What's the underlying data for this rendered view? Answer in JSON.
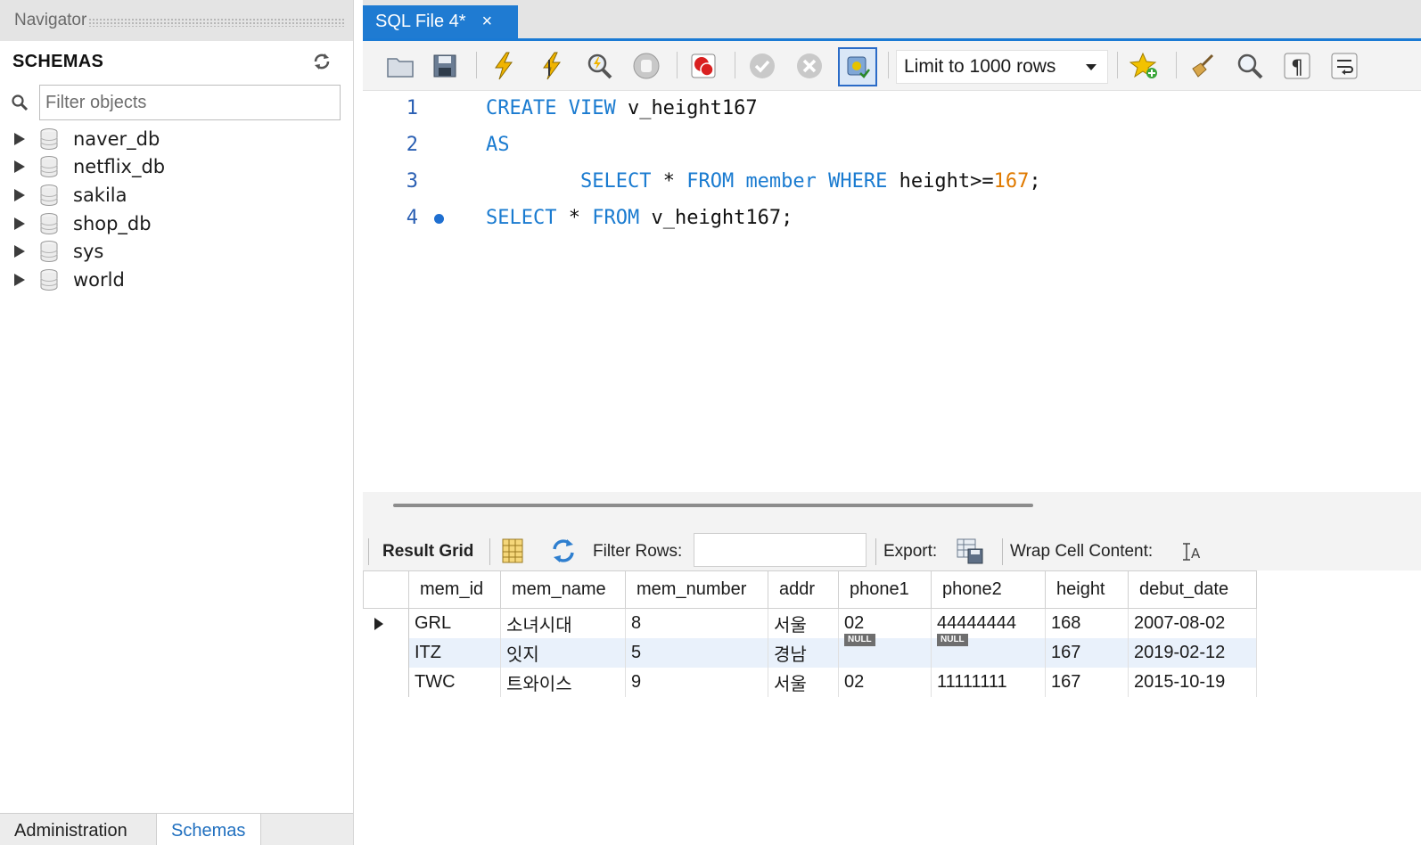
{
  "navigator": {
    "title": "Navigator",
    "schemas_header": "SCHEMAS",
    "filter_placeholder": "Filter objects",
    "schemas": [
      "naver_db",
      "netflix_db",
      "sakila",
      "shop_db",
      "sys",
      "world"
    ],
    "bottom_tabs": {
      "administration": "Administration",
      "schemas": "Schemas"
    },
    "active_bottom_tab": "Schemas"
  },
  "editor": {
    "tab_title": "SQL File 4*",
    "tab_close": "×",
    "limit_label": "Limit to 1000 rows",
    "lines": [
      {
        "number": "1",
        "tokens": [
          {
            "t": "CREATE VIEW",
            "k": "kw"
          },
          {
            "t": " v_height167",
            "k": ""
          }
        ]
      },
      {
        "number": "2",
        "tokens": [
          {
            "t": "AS",
            "k": "kw"
          }
        ]
      },
      {
        "number": "3",
        "tokens": [
          {
            "t": "        ",
            "k": ""
          },
          {
            "t": "SELECT",
            "k": "kw"
          },
          {
            "t": " * ",
            "k": ""
          },
          {
            "t": "FROM",
            "k": "kw"
          },
          {
            "t": " ",
            "k": ""
          },
          {
            "t": "member",
            "k": "kw"
          },
          {
            "t": " ",
            "k": ""
          },
          {
            "t": "WHERE",
            "k": "kw"
          },
          {
            "t": " height>=",
            "k": ""
          },
          {
            "t": "167",
            "k": "num"
          },
          {
            "t": ";",
            "k": ""
          }
        ]
      },
      {
        "number": "4",
        "marker": true,
        "tokens": [
          {
            "t": "SELECT",
            "k": "kw"
          },
          {
            "t": " * ",
            "k": ""
          },
          {
            "t": "FROM",
            "k": "kw"
          },
          {
            "t": " v_height167;",
            "k": ""
          }
        ]
      }
    ]
  },
  "results": {
    "toolbar": {
      "result_grid_label": "Result Grid",
      "filter_rows_label": "Filter Rows:",
      "export_label": "Export:",
      "wrap_label": "Wrap Cell Content:"
    },
    "columns": [
      "mem_id",
      "mem_name",
      "mem_number",
      "addr",
      "phone1",
      "phone2",
      "height",
      "debut_date"
    ],
    "rows": [
      [
        "GRL",
        "소녀시대",
        "8",
        "서울",
        "02",
        "44444444",
        "168",
        "2007-08-02"
      ],
      [
        "ITZ",
        "잇지",
        "5",
        "경남",
        null,
        null,
        "167",
        "2019-02-12"
      ],
      [
        "TWC",
        "트와이스",
        "9",
        "서울",
        "02",
        "11111111",
        "167",
        "2015-10-19"
      ]
    ],
    "null_label": "NULL"
  },
  "colors": {
    "accent": "#1f7bd2",
    "keyword": "#1a7bd0",
    "number": "#e07a00",
    "row_highlight": "#e9f1fb"
  }
}
